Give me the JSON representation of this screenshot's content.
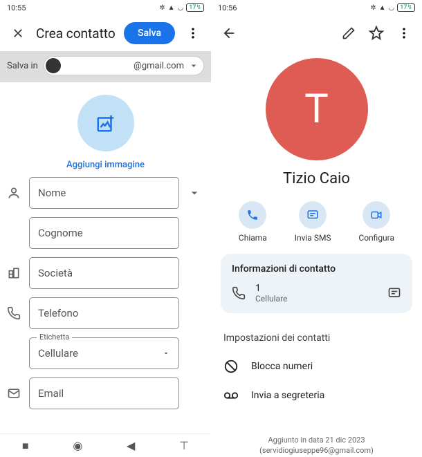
{
  "left": {
    "time": "10:55",
    "battery": "17",
    "title": "Crea contatto",
    "save": "Salva",
    "saveIn": "Salva in",
    "email": "@gmail.com",
    "addImage": "Aggiungi immagine",
    "fields": {
      "nome": "Nome",
      "cognome": "Cognome",
      "societa": "Società",
      "telefono": "Telefono",
      "etichetta": "Etichetta",
      "etichettaVal": "Cellulare",
      "emailLbl": "Email"
    }
  },
  "right": {
    "time": "10:56",
    "battery": "17",
    "avatarLetter": "T",
    "name": "Tizio Caio",
    "actions": {
      "call": "Chiama",
      "sms": "Invia SMS",
      "video": "Configura"
    },
    "infoTitle": "Informazioni di contatto",
    "phoneNum": "1",
    "phoneLbl": "Cellulare",
    "settingsTitle": "Impostazioni dei contatti",
    "block": "Blocca numeri",
    "voicemail": "Invia a segreteria",
    "added1": "Aggiunto in data 21 dic 2023",
    "added2": "(servidiogiuseppe96@gmail.com)"
  }
}
